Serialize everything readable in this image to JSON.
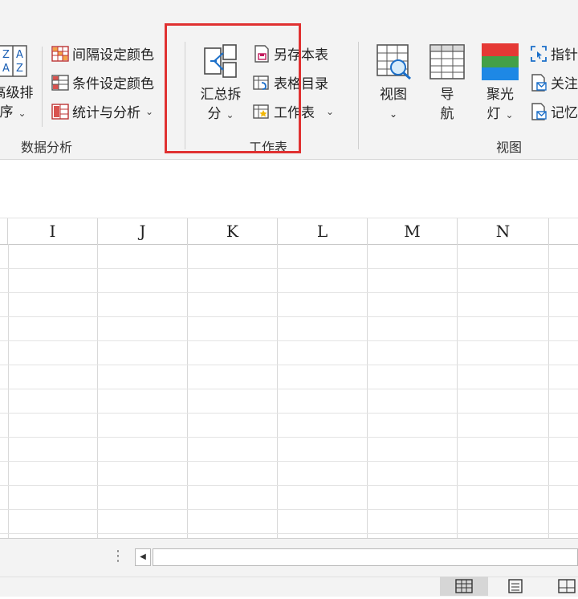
{
  "ribbon": {
    "groups": {
      "data_analysis": "数据分析",
      "worksheet": "工作表",
      "view": "视图"
    },
    "sort": {
      "line1": "高级排",
      "line2": "序"
    },
    "data_items": [
      {
        "label": "间隔设定颜色"
      },
      {
        "label": "条件设定颜色"
      },
      {
        "label": "统计与分析"
      }
    ],
    "summary_split": {
      "line1": "汇总拆",
      "line2": "分"
    },
    "sheet_items": [
      {
        "label": "另存本表"
      },
      {
        "label": "表格目录"
      },
      {
        "label": "工作表"
      }
    ],
    "view_items": [
      {
        "label": "视图"
      },
      {
        "line1": "导",
        "line2": "航"
      },
      {
        "line1": "聚光",
        "line2": "灯"
      }
    ],
    "right_items": [
      {
        "label": "指针"
      },
      {
        "label": "关注"
      },
      {
        "label": "记忆"
      }
    ]
  },
  "grid": {
    "columns": [
      "I",
      "J",
      "K",
      "L",
      "M",
      "N"
    ]
  },
  "colors": {
    "highlight": "#e03131",
    "spotlight_red": "#e53935",
    "spotlight_green": "#43a047",
    "spotlight_blue": "#1e88e5"
  }
}
